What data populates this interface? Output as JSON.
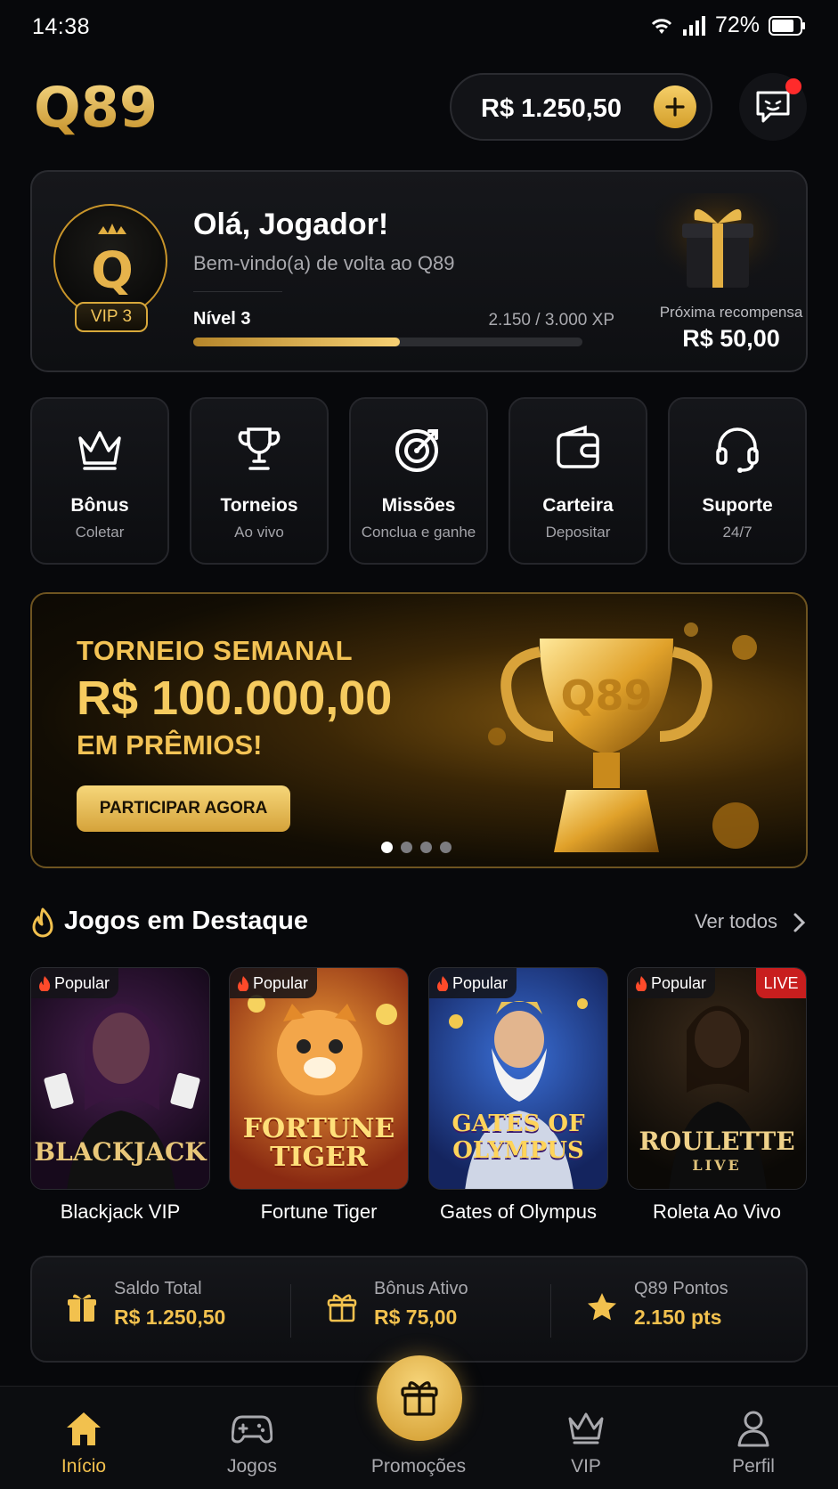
{
  "status_bar": {
    "time": "14:38",
    "battery": "72%"
  },
  "header": {
    "logo": "Q89",
    "balance": "R$ 1.250,50"
  },
  "welcome": {
    "vip_label": "VIP 3",
    "greeting": "Olá, Jogador!",
    "subtitle": "Bem-vindo(a) de volta ao Q89",
    "level": "Nível 3",
    "xp": "2.150 / 3.000 XP",
    "xp_progress": 0.53,
    "next_reward_label": "Próxima recompensa",
    "next_reward_value": "R$ 50,00"
  },
  "quick_actions": [
    {
      "title": "Bônus",
      "subtitle": "Coletar",
      "icon": "crown-icon"
    },
    {
      "title": "Torneios",
      "subtitle": "Ao vivo",
      "icon": "trophy-icon"
    },
    {
      "title": "Missões",
      "subtitle": "Conclua e ganhe",
      "icon": "target-icon"
    },
    {
      "title": "Carteira",
      "subtitle": "Depositar",
      "icon": "wallet-icon"
    },
    {
      "title": "Suporte",
      "subtitle": "24/7",
      "icon": "headset-icon"
    }
  ],
  "banner": {
    "line1": "TORNEIO SEMANAL",
    "line2": "R$ 100.000,00",
    "line3": "EM PRÊMIOS!",
    "cta": "PARTICIPAR AGORA",
    "trophy_logo": "Q89",
    "slides": 4,
    "active_slide": 1
  },
  "featured": {
    "title": "Jogos em Destaque",
    "see_all": "Ver todos",
    "games": [
      {
        "name": "Blackjack VIP",
        "tag": "Popular",
        "art_text": "BLACKJACK",
        "live": ""
      },
      {
        "name": "Fortune Tiger",
        "tag": "Popular",
        "art_text": "FORTUNE TIGER",
        "live": ""
      },
      {
        "name": "Gates of Olympus",
        "tag": "Popular",
        "art_text": "GATES OF OLYMPUS",
        "live": ""
      },
      {
        "name": "Roleta Ao Vivo",
        "tag": "Popular",
        "art_text": "ROULETTE",
        "art_sub": "LIVE",
        "live": "LIVE"
      }
    ]
  },
  "summary": [
    {
      "label": "Saldo Total",
      "value": "R$ 1.250,50",
      "icon": "gift-icon"
    },
    {
      "label": "Bônus Ativo",
      "value": "R$ 75,00",
      "icon": "gift-outline-icon"
    },
    {
      "label": "Q89 Pontos",
      "value": "2.150 pts",
      "icon": "star-icon"
    }
  ],
  "nav": [
    {
      "label": "Início",
      "icon": "home-icon",
      "active": true
    },
    {
      "label": "Jogos",
      "icon": "gamepad-icon",
      "active": false
    },
    {
      "label": "Promoções",
      "icon": "gift-icon",
      "active": false
    },
    {
      "label": "VIP",
      "icon": "crown-icon",
      "active": false
    },
    {
      "label": "Perfil",
      "icon": "user-icon",
      "active": false
    }
  ],
  "colors": {
    "accent": "#f2c14e",
    "background": "#07080b",
    "live": "#c81e1e"
  }
}
